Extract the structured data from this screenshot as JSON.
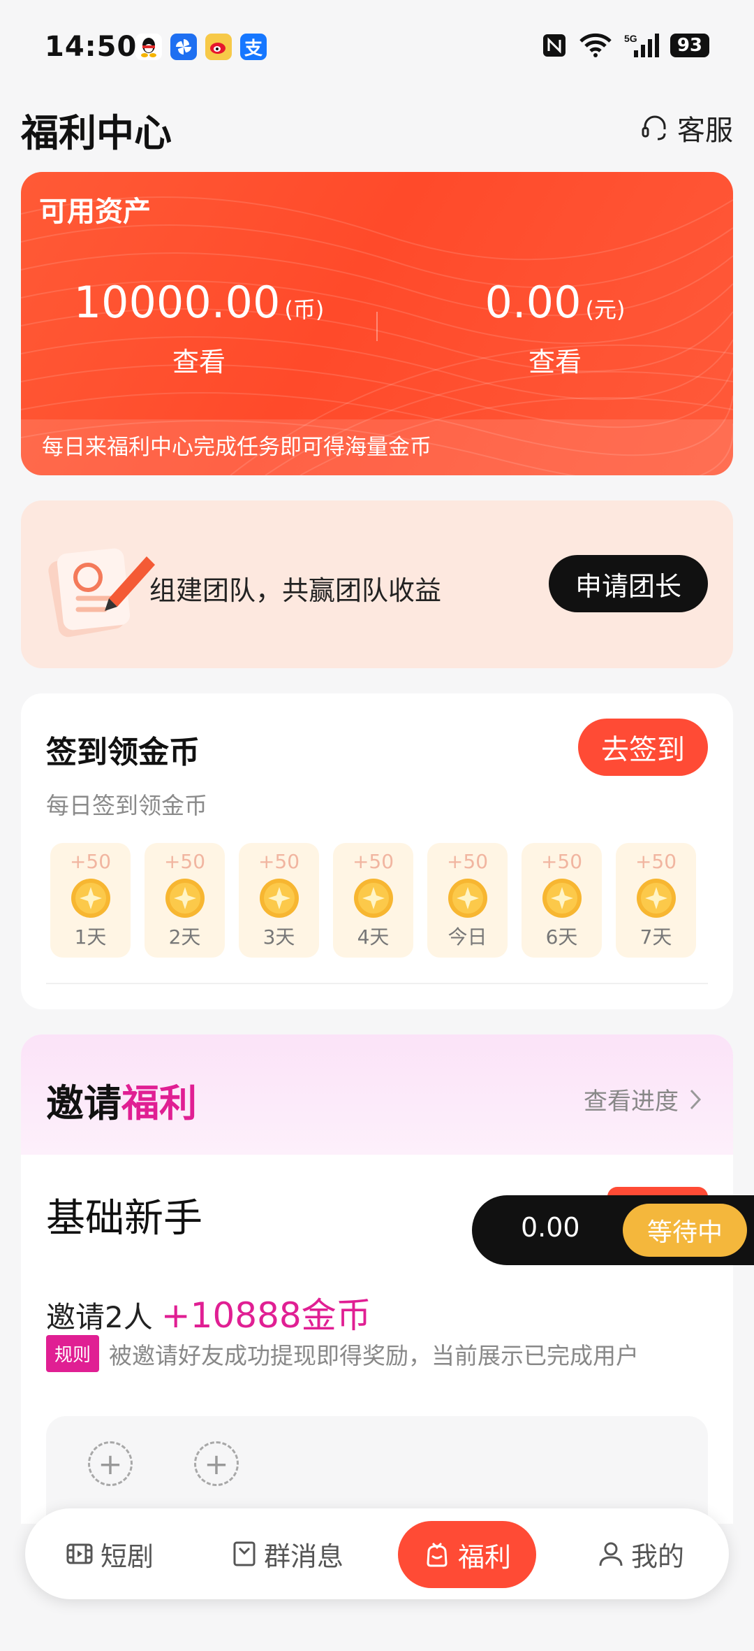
{
  "status_bar": {
    "time": "14:50",
    "battery": "93",
    "network": "5G"
  },
  "header": {
    "title": "福利中心",
    "service_label": "客服"
  },
  "assets": {
    "label": "可用资产",
    "coins": {
      "amount": "10000.00",
      "unit": "(币)",
      "view": "查看"
    },
    "cash": {
      "amount": "0.00",
      "unit": "(元)",
      "view": "查看"
    },
    "footer": "每日来福利中心完成任务即可得海量金币"
  },
  "team": {
    "text": "组建团队，共赢团队收益",
    "button": "申请团长"
  },
  "sign_in": {
    "title": "签到领金币",
    "subtitle": "每日签到领金币",
    "button": "去签到",
    "days": [
      {
        "bonus": "+50",
        "label": "1天"
      },
      {
        "bonus": "+50",
        "label": "2天"
      },
      {
        "bonus": "+50",
        "label": "3天"
      },
      {
        "bonus": "+50",
        "label": "4天"
      },
      {
        "bonus": "+50",
        "label": "今日"
      },
      {
        "bonus": "+50",
        "label": "6天"
      },
      {
        "bonus": "+50",
        "label": "7天"
      }
    ]
  },
  "invite": {
    "title_plain": "邀请",
    "title_accent": "福利",
    "progress_link": "查看进度",
    "tier": "基础新手",
    "count_text": "邀请2人",
    "reward": "+10888金币",
    "rule_badge": "规则",
    "rule_text": "被邀请好友成功提现即得奖励，当前展示已完成用户"
  },
  "floating": {
    "amount": "0.00",
    "status": "等待中"
  },
  "nav": [
    {
      "label": "短剧",
      "icon": "film-icon"
    },
    {
      "label": "群消息",
      "icon": "message-box-icon"
    },
    {
      "label": "福利",
      "icon": "gift-bag-icon"
    },
    {
      "label": "我的",
      "icon": "user-icon"
    }
  ],
  "colors": {
    "accent": "#ff4b35",
    "invite_accent": "#e01f93",
    "float_status": "#f4b73c"
  }
}
